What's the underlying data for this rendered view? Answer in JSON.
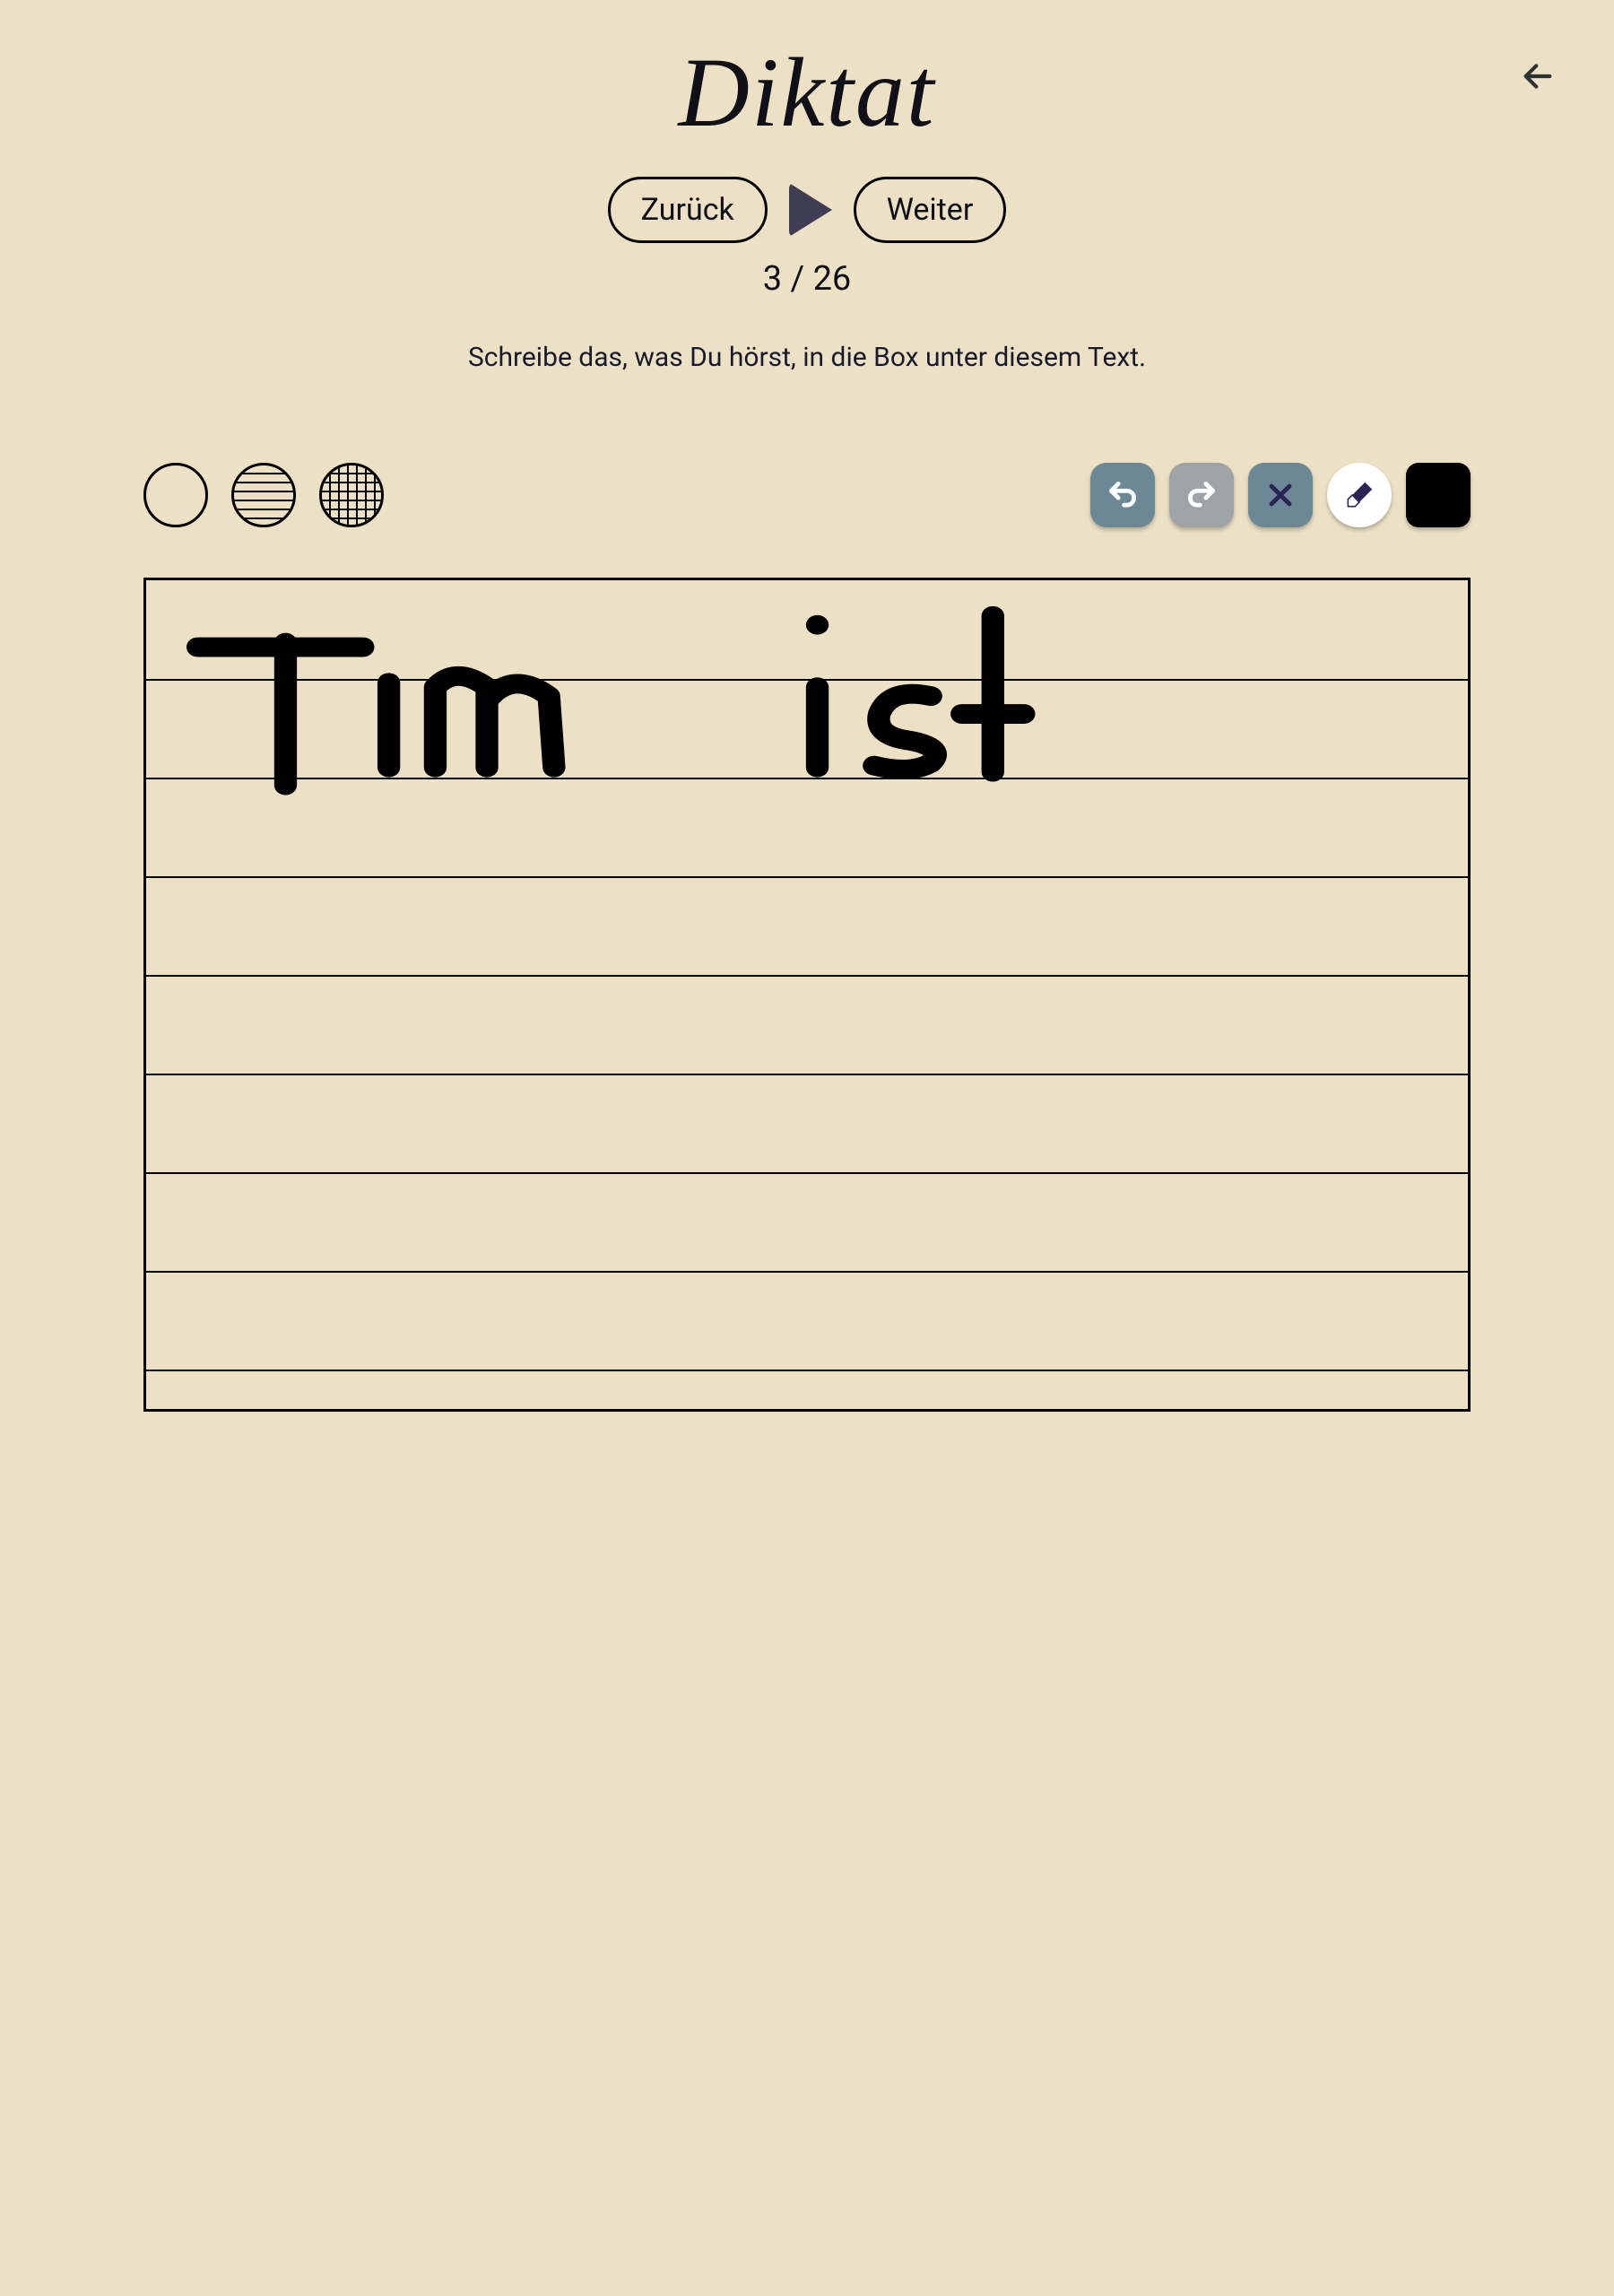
{
  "title": "Diktat",
  "nav": {
    "back_label": "Zurück",
    "next_label": "Weiter"
  },
  "progress": {
    "current": 3,
    "total": 26,
    "text": "3 / 26"
  },
  "instruction": "Schreibe das, was Du hörst, in die Box unter diesem Text.",
  "tools": {
    "undo": "undo",
    "redo": "redo",
    "clear": "clear",
    "eraser": "eraser",
    "color": "#000000"
  },
  "line_styles": {
    "blank": "blank",
    "ruled": "ruled",
    "grid": "grid",
    "selected": "ruled"
  },
  "handwriting": {
    "words": [
      "Tim",
      "ist"
    ]
  }
}
